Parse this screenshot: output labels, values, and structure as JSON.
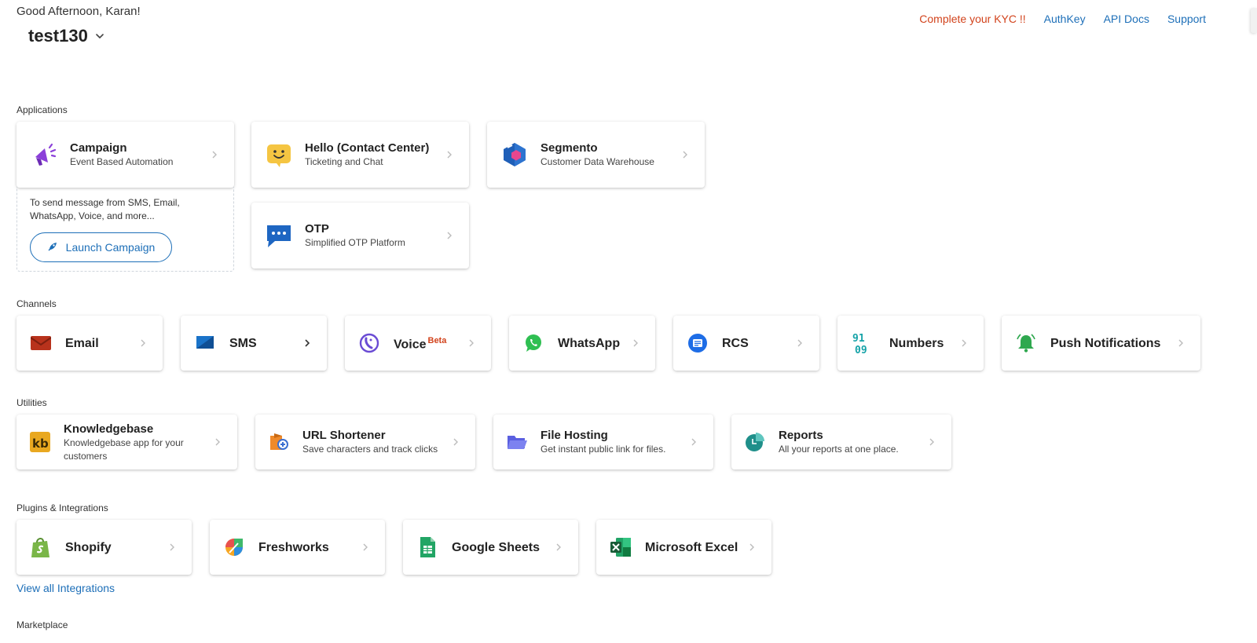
{
  "header": {
    "greeting": "Good Afternoon, Karan!",
    "workspace": "test130",
    "links": {
      "kyc": "Complete your KYC !!",
      "authkey": "AuthKey",
      "api_docs": "API Docs",
      "support": "Support"
    }
  },
  "sections": {
    "applications": "Applications",
    "channels": "Channels",
    "utilities": "Utilities",
    "plugins": "Plugins & Integrations",
    "marketplace": "Marketplace"
  },
  "applications": {
    "campaign": {
      "title": "Campaign",
      "subtitle": "Event Based Automation",
      "icon": "megaphone-icon"
    },
    "hello": {
      "title": "Hello (Contact Center)",
      "subtitle": "Ticketing and Chat",
      "icon": "smiley-chat-icon"
    },
    "segmento": {
      "title": "Segmento",
      "subtitle": "Customer Data Warehouse",
      "icon": "hexagon-icon"
    },
    "otp": {
      "title": "OTP",
      "subtitle": "Simplified OTP Platform",
      "icon": "chat-dots-icon"
    },
    "campaign_desc": "To send message from SMS, Email, WhatsApp, Voice, and more...",
    "launch_label": "Launch Campaign"
  },
  "channels": {
    "email": "Email",
    "sms": "SMS",
    "voice": "Voice",
    "voice_badge": "Beta",
    "whatsapp": "WhatsApp",
    "rcs": "RCS",
    "numbers": "Numbers",
    "push": "Push Notifications"
  },
  "utilities": {
    "knowledgebase": {
      "title": "Knowledgebase",
      "subtitle": "Knowledgebase app for your customers"
    },
    "url_shortener": {
      "title": "URL Shortener",
      "subtitle": "Save characters and track clicks"
    },
    "file_hosting": {
      "title": "File Hosting",
      "subtitle": "Get instant public link for files."
    },
    "reports": {
      "title": "Reports",
      "subtitle": "All your reports at one place."
    }
  },
  "plugins": {
    "shopify": "Shopify",
    "freshworks": "Freshworks",
    "google_sheets": "Google Sheets",
    "microsoft_excel": "Microsoft Excel",
    "view_all": "View all Integrations"
  },
  "colors": {
    "link": "#1d6fb8",
    "kyc": "#d2431c",
    "campaign": "#8b3fd9",
    "hello": "#f5c542",
    "segmento": "#1f5fb8",
    "otp": "#1e66c2"
  }
}
